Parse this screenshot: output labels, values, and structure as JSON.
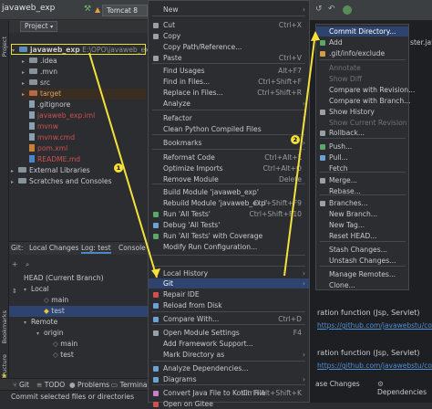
{
  "toolbar": {
    "project_name": "javaweb_exp",
    "run_config": "Tomcat 8"
  },
  "left_stripe": {
    "project_label": "Project",
    "bookmarks_label": "Bookmarks",
    "structure_label": "Structure"
  },
  "project_panel": {
    "selector_label": "Project",
    "tree": [
      {
        "label": "javaweb_exp",
        "suffix": "E:\\OPO\\javaweb_exp",
        "kind": "folder"
      },
      {
        "label": ".idea",
        "kind": "folder"
      },
      {
        "label": ".mvn",
        "kind": "folder"
      },
      {
        "label": "src",
        "kind": "folder"
      },
      {
        "label": "target",
        "kind": "folder-red"
      },
      {
        "label": ".gitignore",
        "kind": "file"
      },
      {
        "label": "javaweb_exp.iml",
        "kind": "file"
      },
      {
        "label": "mvnw",
        "kind": "file"
      },
      {
        "label": "mvnw.cmd",
        "kind": "file"
      },
      {
        "label": "pom.xml",
        "kind": "file-orange"
      },
      {
        "label": "README.md",
        "kind": "file-blue"
      },
      {
        "label": "External Libraries",
        "kind": "lib"
      },
      {
        "label": "Scratches and Consoles",
        "kind": "scratch"
      }
    ]
  },
  "git_panel": {
    "tabs": [
      "Git:",
      "Local Changes",
      "Log: test",
      "Console"
    ],
    "branches": [
      {
        "label": "HEAD (Current Branch)"
      },
      {
        "label": "Local"
      },
      {
        "label": "main"
      },
      {
        "label": "test"
      },
      {
        "label": "Remote"
      },
      {
        "label": "origin"
      },
      {
        "label": "main"
      },
      {
        "label": "test"
      }
    ]
  },
  "bottom_tabs": [
    "Git",
    "TODO",
    "Problems",
    "Terminal"
  ],
  "status_text": "Commit selected files or directories",
  "context_menu": {
    "items": [
      {
        "label": "New",
        "shortcut": ""
      },
      {
        "label": "Cut",
        "shortcut": "Ctrl+X"
      },
      {
        "label": "Copy",
        "shortcut": ""
      },
      {
        "label": "Copy Path/Reference...",
        "shortcut": ""
      },
      {
        "label": "Paste",
        "shortcut": "Ctrl+V"
      },
      {
        "label": "Find Usages",
        "shortcut": "Alt+F7"
      },
      {
        "label": "Find in Files...",
        "shortcut": "Ctrl+Shift+F"
      },
      {
        "label": "Replace in Files...",
        "shortcut": "Ctrl+Shift+R"
      },
      {
        "label": "Analyze",
        "shortcut": ""
      },
      {
        "label": "Refactor",
        "shortcut": ""
      },
      {
        "label": "Clean Python Compiled Files",
        "shortcut": ""
      },
      {
        "label": "Bookmarks",
        "shortcut": ""
      },
      {
        "label": "Reformat Code",
        "shortcut": "Ctrl+Alt+L"
      },
      {
        "label": "Optimize Imports",
        "shortcut": "Ctrl+Alt+O"
      },
      {
        "label": "Remove Module",
        "shortcut": "Delete"
      },
      {
        "label": "Build Module 'javaweb_exp'",
        "shortcut": ""
      },
      {
        "label": "Rebuild Module 'javaweb_exp'",
        "shortcut": "Ctrl+Shift+F9"
      },
      {
        "label": "Run 'All Tests'",
        "shortcut": "Ctrl+Shift+F10"
      },
      {
        "label": "Debug 'All Tests'",
        "shortcut": ""
      },
      {
        "label": "Run 'All Tests' with Coverage",
        "shortcut": ""
      },
      {
        "label": "Modify Run Configuration...",
        "shortcut": ""
      },
      {
        "label": "Local History",
        "shortcut": ""
      },
      {
        "label": "Git",
        "shortcut": ""
      },
      {
        "label": "Repair IDE",
        "shortcut": ""
      },
      {
        "label": "Reload from Disk",
        "shortcut": ""
      },
      {
        "label": "Compare With...",
        "shortcut": "Ctrl+D"
      },
      {
        "label": "Open Module Settings",
        "shortcut": "F4"
      },
      {
        "label": "Add Framework Support...",
        "shortcut": ""
      },
      {
        "label": "Mark Directory as",
        "shortcut": ""
      },
      {
        "label": "Analyze Dependencies...",
        "shortcut": ""
      },
      {
        "label": "Diagrams",
        "shortcut": ""
      },
      {
        "label": "Convert Java File to Kotlin File",
        "shortcut": "Ctrl+Alt+Shift+K"
      },
      {
        "label": "Open on Gitee",
        "shortcut": ""
      }
    ]
  },
  "git_submenu": {
    "items": [
      {
        "label": "Commit Directory...",
        "state": "active"
      },
      {
        "label": "Add",
        "state": ""
      },
      {
        "label": ".git/info/exclude",
        "state": ""
      },
      {
        "label": "Annotate",
        "state": "disabled"
      },
      {
        "label": "Show Diff",
        "state": "disabled"
      },
      {
        "label": "Compare with Revision...",
        "state": ""
      },
      {
        "label": "Compare with Branch...",
        "state": ""
      },
      {
        "label": "Show History",
        "state": ""
      },
      {
        "label": "Show Current Revision",
        "state": "disabled"
      },
      {
        "label": "Rollback...",
        "state": ""
      },
      {
        "label": "Push...",
        "state": ""
      },
      {
        "label": "Pull...",
        "state": ""
      },
      {
        "label": "Fetch",
        "state": ""
      },
      {
        "label": "Merge...",
        "state": ""
      },
      {
        "label": "Rebase...",
        "state": ""
      },
      {
        "label": "Branches...",
        "state": ""
      },
      {
        "label": "New Branch...",
        "state": ""
      },
      {
        "label": "New Tag...",
        "state": ""
      },
      {
        "label": "Reset HEAD...",
        "state": ""
      },
      {
        "label": "Stash Changes...",
        "state": ""
      },
      {
        "label": "Unstash Changes...",
        "state": ""
      },
      {
        "label": "Manage Remotes...",
        "state": ""
      },
      {
        "label": "Clone...",
        "state": ""
      }
    ]
  },
  "right_area": {
    "editor_snippets": [
      "ster.java",
      "ration function (Jsp, Servlet)",
      "https://github.com/javawebstu/cod",
      "ration function (Jsp, Servlet)",
      "https://github.com/javawebstu/cod"
    ],
    "bottom_tabs": [
      "ase Changes",
      "Dependencies"
    ]
  },
  "annotations": {
    "badge1": "1",
    "badge2": "2"
  },
  "colors": {
    "selection": "#2e436e",
    "arrow": "#f5e13a",
    "highlight_box": "#e8e02e",
    "link": "#4f8fd6"
  }
}
